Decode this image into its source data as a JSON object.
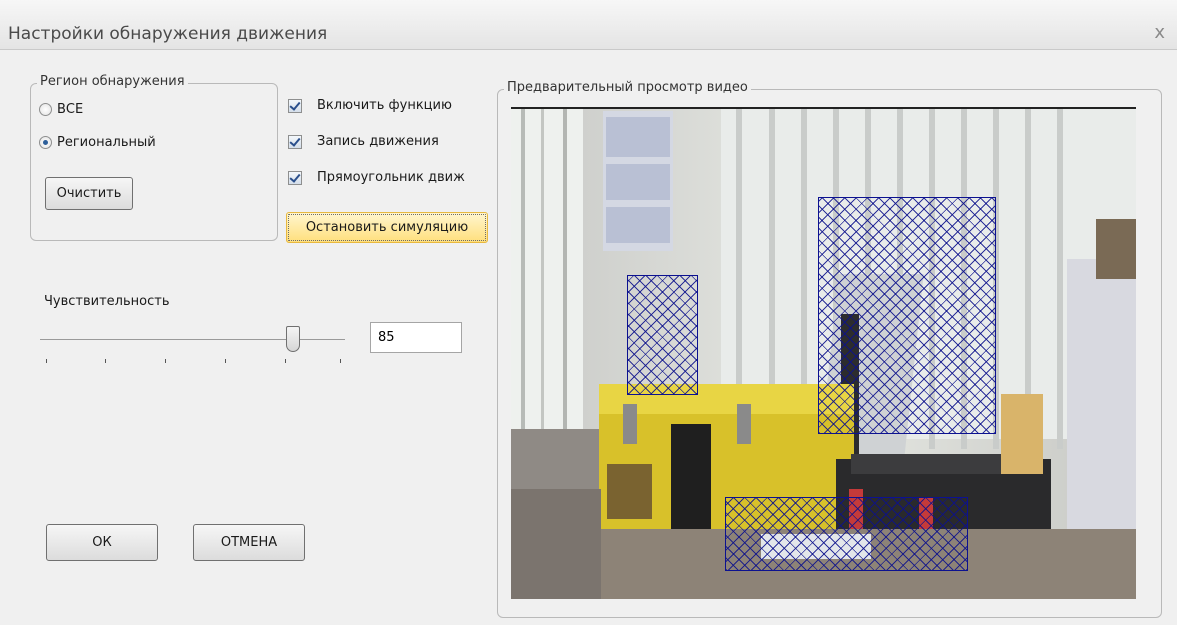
{
  "window": {
    "title": "Настройки обнаружения движения",
    "close_glyph": "x"
  },
  "region_group": {
    "legend": "Регион обнаружения",
    "options": [
      {
        "label": "ВСЕ",
        "checked": false
      },
      {
        "label": "Региональный",
        "checked": true
      }
    ],
    "clear_button": "Очистить"
  },
  "checkboxes": [
    {
      "label": "Включить функцию",
      "checked": true
    },
    {
      "label": "Запись движения",
      "checked": true
    },
    {
      "label": "Прямоугольник движ",
      "checked": true
    }
  ],
  "simulation_button": "Остановить симуляцию",
  "sensitivity": {
    "label": "Чувствительность",
    "value": "85",
    "level_percent": 85
  },
  "buttons": {
    "ok": "ОК",
    "cancel": "ОТМЕНА"
  },
  "preview": {
    "legend": "Предварительный просмотр видео",
    "scene_image": "office-camera-feed",
    "region_count": 3
  },
  "colors": {
    "background": "#f0f0f0",
    "region_hatch": "#0c1190",
    "sim_button": "#ffdf7c"
  }
}
